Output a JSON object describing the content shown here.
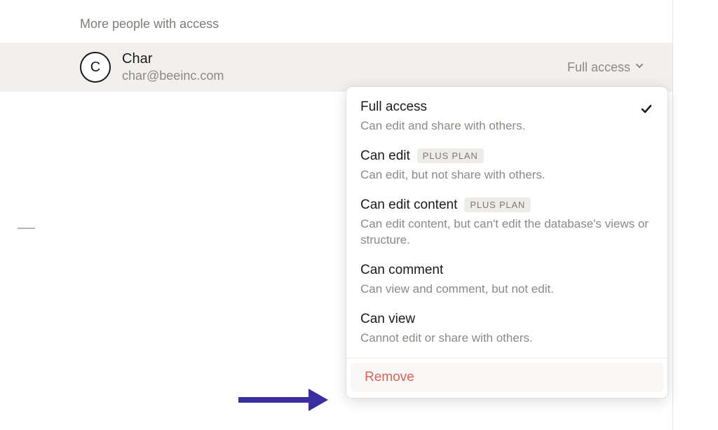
{
  "section": {
    "title": "More people with access"
  },
  "user": {
    "avatar_letter": "C",
    "name": "Char",
    "email": "char@beeinc.com",
    "current_access": "Full access"
  },
  "menu": {
    "options": [
      {
        "title": "Full access",
        "description": "Can edit and share with others.",
        "selected": true
      },
      {
        "title": "Can edit",
        "description": "Can edit, but not share with others.",
        "badge": "PLUS PLAN"
      },
      {
        "title": "Can edit content",
        "description": "Can edit content, but can't edit the database's views or structure.",
        "badge": "PLUS PLAN"
      },
      {
        "title": "Can comment",
        "description": "Can view and comment, but not edit."
      },
      {
        "title": "Can view",
        "description": "Cannot edit or share with others."
      }
    ],
    "remove_label": "Remove"
  }
}
